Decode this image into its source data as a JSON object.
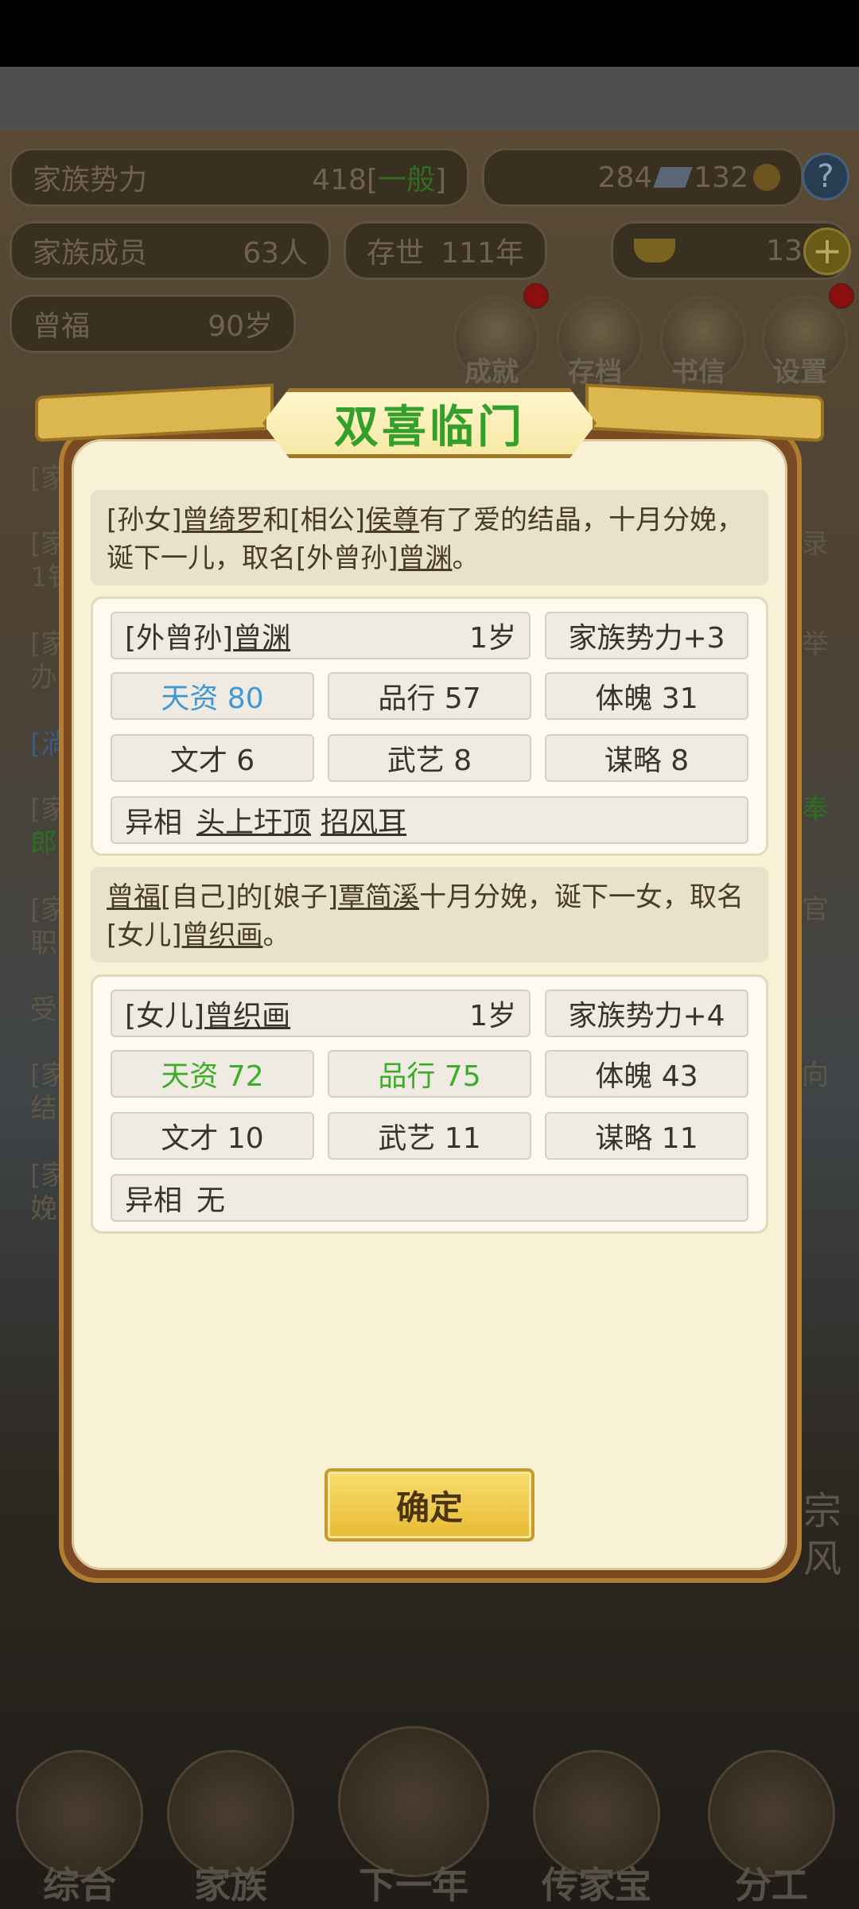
{
  "background": {
    "clan_power_label": "家族势力",
    "clan_power_value": "418",
    "clan_power_tag_open": "[",
    "clan_power_tag": "一般",
    "clan_power_tag_close": "]",
    "currency_a": "284",
    "currency_b": "132",
    "help_label": "?",
    "members_label": "家族成员",
    "members_value": "63人",
    "existence_label": "存世",
    "existence_value": "111年",
    "gold_value": "13",
    "plus_label": "+",
    "patriarch_name": "曾福",
    "patriarch_age": "90岁",
    "menu": [
      "成就",
      "存档",
      "书信",
      "设置"
    ],
    "log_lines": [
      "[家",
      "[家",
      "1钅",
      "[家",
      "办",
      "[淌",
      "[家",
      "郎",
      "[家",
      "职",
      "受",
      "[家",
      "结",
      "[家",
      "娩"
    ],
    "right_lines": [
      "录",
      "举",
      "奉",
      "官",
      "向"
    ],
    "side_right": [
      "宗",
      "风"
    ],
    "nav": [
      "综合",
      "家族",
      "下一年",
      "传家宝",
      "分工"
    ]
  },
  "dialog": {
    "title": "双喜临门",
    "event1": {
      "p1": "[孙女]",
      "name1": "曾绮罗",
      "p2": "和[相公]",
      "name2": "侯尊",
      "p3": "有了爱的结晶，十月分娩，诞下一儿，取名[外曾孙]",
      "name3": "曾渊",
      "p4": "。"
    },
    "child1": {
      "relation": "[外曾孙]",
      "name": "曾渊",
      "age": "1岁",
      "power": "家族势力+3",
      "talent": "天资  80",
      "conduct": "品行  57",
      "physique": "体魄  31",
      "literary": "文才  6",
      "martial": "武艺  8",
      "strategy": "谋略  8",
      "trait_label": "异相",
      "trait1": "头上圩顶",
      "trait2": "招风耳"
    },
    "event2": {
      "name1": "曾福",
      "p1": "[自己]的[娘子]",
      "name2": "覃简溪",
      "p2": "十月分娩，诞下一女，取名[女儿]",
      "name3": "曾织画",
      "p3": "。"
    },
    "child2": {
      "relation": "[女儿]",
      "name": "曾织画",
      "age": "1岁",
      "power": "家族势力+4",
      "talent": "天资  72",
      "conduct": "品行  75",
      "physique": "体魄  43",
      "literary": "文才  10",
      "martial": "武艺  11",
      "strategy": "谋略  11",
      "trait_label": "异相",
      "trait_value": "无"
    },
    "confirm_label": "确定"
  },
  "colors": {
    "title_green": "#32a02a",
    "talent_blue": "#3e97d6",
    "highlight_green": "#3dad29"
  }
}
